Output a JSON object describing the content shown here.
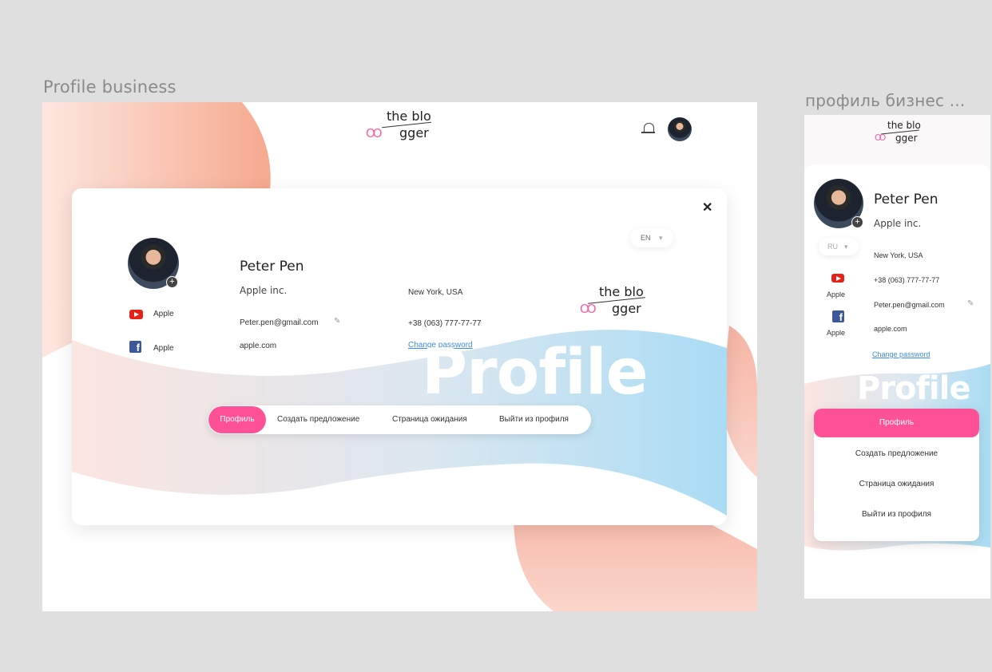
{
  "frames": {
    "desktop_title": "Profile business",
    "mobile_title": "профиль бизнес ..."
  },
  "logo": {
    "line1": "the blo",
    "line2": "gger",
    "rings": "OO"
  },
  "profile": {
    "name": "Peter Pen",
    "company": "Apple inc.",
    "location": "New York, USA",
    "email": "Peter.pen@gmail.com",
    "phone": "+38 (063) 777-77-77",
    "website": "apple.com",
    "change_password": "Change password"
  },
  "social": [
    {
      "icon": "youtube-icon",
      "label": "Apple"
    },
    {
      "icon": "facebook-icon",
      "label": "Apple"
    }
  ],
  "language": {
    "desktop": "EN",
    "mobile": "RU"
  },
  "watermark": "Profile",
  "tabs": [
    {
      "label": "Профиль",
      "active": true
    },
    {
      "label": "Создать предложение",
      "active": false
    },
    {
      "label": "Страница ожидания",
      "active": false
    },
    {
      "label": "Выйти из профиля",
      "active": false
    }
  ],
  "icons": {
    "close": "✕",
    "edit": "✎",
    "plus": "+",
    "chevron": "▾"
  },
  "colors": {
    "accent": "#ff5296",
    "link": "#3b8de3",
    "peach": "#f7b9a2",
    "sky": "#a7dcf5"
  }
}
